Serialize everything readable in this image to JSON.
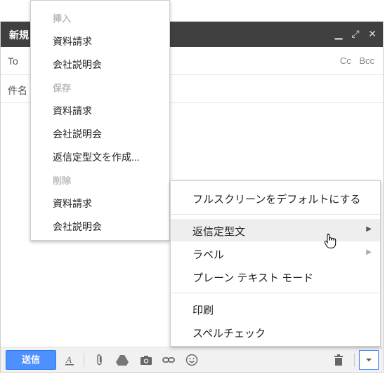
{
  "compose": {
    "title": "新規",
    "to_label": "To",
    "cc_label": "Cc",
    "bcc_label": "Bcc",
    "subject_label": "件名",
    "send_label": "送信"
  },
  "templates_menu": {
    "insert_header": "挿入",
    "insert_items": [
      "資料請求",
      "会社説明会"
    ],
    "save_header": "保存",
    "save_items": [
      "資料請求",
      "会社説明会",
      "返信定型文を作成..."
    ],
    "delete_header": "削除",
    "delete_items": [
      "資料請求",
      "会社説明会"
    ]
  },
  "more_menu": {
    "fullscreen_default": "フルスクリーンをデフォルトにする",
    "canned_responses": "返信定型文",
    "label": "ラベル",
    "plain_text": "プレーン テキスト モード",
    "print": "印刷",
    "spellcheck": "スペルチェック"
  },
  "colors": {
    "title_bar": "#404040",
    "send_button": "#4d90fe",
    "highlight": "#eeeeee"
  }
}
